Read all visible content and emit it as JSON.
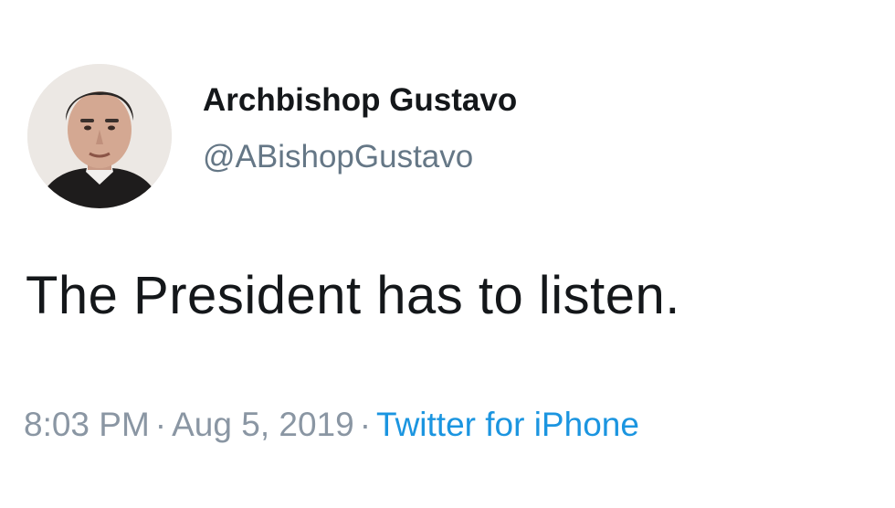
{
  "tweet": {
    "author": {
      "name": "Archbishop Gustavo",
      "handle": "@ABishopGustavo"
    },
    "text": "The President has to listen.",
    "time": "8:03 PM",
    "separator": "·",
    "date": "Aug 5, 2019",
    "source": "Twitter for iPhone"
  },
  "colors": {
    "text": "#14171a",
    "secondary": "#657786",
    "link": "#1b95e0"
  }
}
